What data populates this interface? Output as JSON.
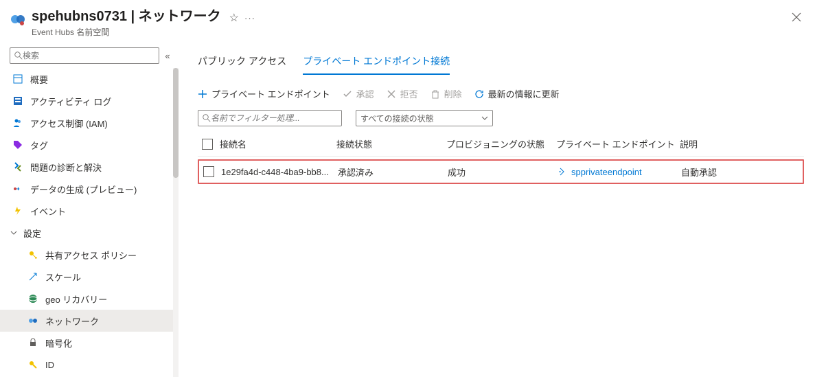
{
  "header": {
    "title_left": "spehubns0731",
    "title_right": "ネットワーク",
    "subtitle": "Event Hubs 名前空間"
  },
  "sidebar": {
    "search_placeholder": "検索",
    "items": [
      {
        "label": "概要"
      },
      {
        "label": "アクティビティ ログ"
      },
      {
        "label": "アクセス制御 (IAM)"
      },
      {
        "label": "タグ"
      },
      {
        "label": "問題の診断と解決"
      },
      {
        "label": "データの生成 (プレビュー)"
      },
      {
        "label": "イベント"
      }
    ],
    "settings_header": "設定",
    "settings_items": [
      {
        "label": "共有アクセス ポリシー"
      },
      {
        "label": "スケール"
      },
      {
        "label": "geo リカバリー"
      },
      {
        "label": "ネットワーク"
      },
      {
        "label": "暗号化"
      },
      {
        "label": "ID"
      }
    ]
  },
  "tabs": {
    "public": "パブリック アクセス",
    "private": "プライベート エンドポイント接続"
  },
  "toolbar": {
    "add": "プライベート エンドポイント",
    "approve": "承認",
    "reject": "拒否",
    "delete": "削除",
    "refresh": "最新の情報に更新"
  },
  "filters": {
    "name_placeholder": "名前でフィルター処理...",
    "state_label": "すべての接続の状態"
  },
  "table": {
    "columns": {
      "name": "接続名",
      "state": "接続状態",
      "provisioning": "プロビジョニングの状態",
      "endpoint": "プライベート エンドポイント",
      "description": "説明"
    },
    "rows": [
      {
        "name": "1e29fa4d-c448-4ba9-bb8...",
        "state": "承認済み",
        "provisioning": "成功",
        "endpoint": "spprivateendpoint",
        "description": "自動承認"
      }
    ]
  }
}
